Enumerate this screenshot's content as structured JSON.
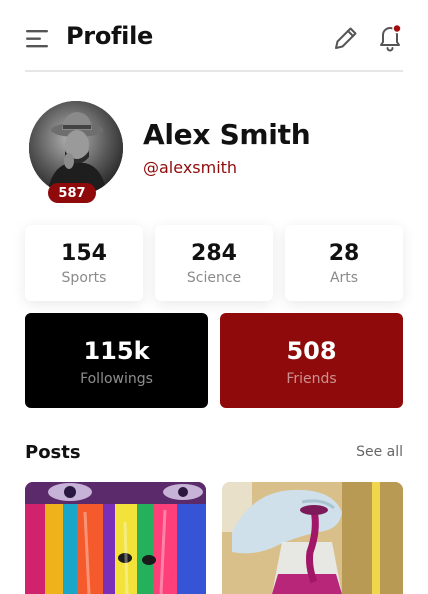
{
  "header": {
    "title": "Profile",
    "icons": [
      "menu-icon",
      "edit-icon",
      "bell-icon"
    ],
    "notification_dot_color": "#a10b0b"
  },
  "profile": {
    "name": "Alex Smith",
    "handle": "@alexsmith",
    "score": "587",
    "accent_color": "#8f0a0a"
  },
  "stats": [
    {
      "value": "154",
      "label": "Sports"
    },
    {
      "value": "284",
      "label": "Science"
    },
    {
      "value": "28",
      "label": "Arts"
    }
  ],
  "highlights": [
    {
      "value": "115k",
      "label": "Followings",
      "color": "#000000"
    },
    {
      "value": "508",
      "label": "Friends",
      "color": "#8f0a0a"
    }
  ],
  "posts": {
    "title": "Posts",
    "see_all": "See all"
  }
}
